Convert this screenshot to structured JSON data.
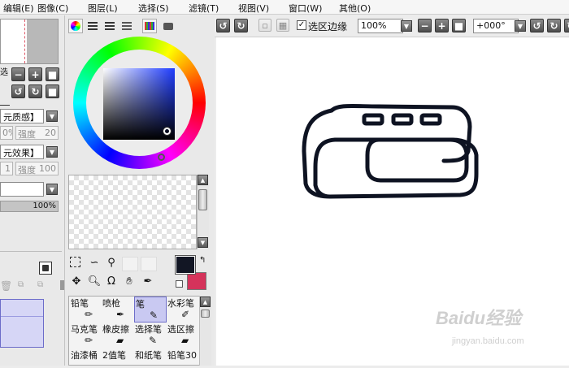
{
  "menu": {
    "items": [
      "编辑(E)",
      "图像(C)",
      "图层(L)",
      "选择(S)",
      "滤镜(T)",
      "视图(V)",
      "窗口(W)",
      "其他(O)"
    ]
  },
  "left_panel": {
    "texture_label": "元质感】",
    "texture_percent": "0%",
    "texture_strength_label": "强度",
    "texture_strength_value": "20",
    "effect_label": "元效果】",
    "effect_value": "1",
    "effect_strength_label": "强度",
    "effect_strength_value": "100",
    "opacity_value": "100%",
    "side_labels": [
      "选",
      ""
    ]
  },
  "color_panel": {
    "fg_color": "#121624",
    "bg_color": "#d5335b"
  },
  "toolbar": {
    "selection_edge_label": "选区边缘",
    "selection_edge_checked": true,
    "zoom_value": "100%",
    "rotation_value": "+000°"
  },
  "brushes": {
    "row1": [
      "铅笔",
      "喷枪",
      "笔",
      "水彩笔"
    ],
    "row2": [
      "马克笔",
      "橡皮擦",
      "选择笔",
      "选区擦"
    ],
    "row3": [
      "油漆桶",
      "2值笔",
      "和纸笔",
      "铅笔30"
    ],
    "selected": "笔"
  },
  "watermark": {
    "brand": "Baidu经验",
    "url": "jingyan.baidu.com"
  }
}
